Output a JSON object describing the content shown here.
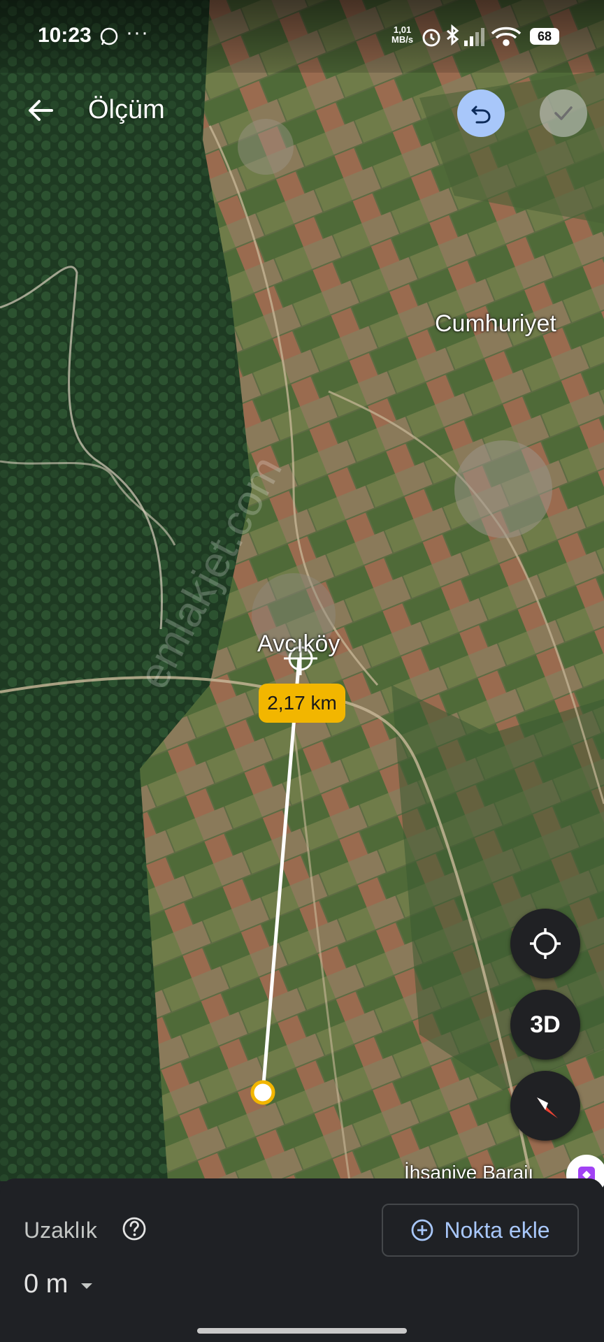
{
  "status_bar": {
    "time": "10:23",
    "dots": "···",
    "speed_value": "1,01",
    "speed_unit": "MB/s",
    "battery": "68"
  },
  "header": {
    "title": "Ölçüm",
    "back_icon": "arrow-left-icon",
    "undo_icon": "undo-icon",
    "done_icon": "check-icon"
  },
  "map": {
    "labels": {
      "village_1": "Cumhuriyet",
      "village_2": "Avcıköy",
      "village_3": "İhsaniye Barajı"
    },
    "distance_label": "2,17 km",
    "watermark": "emlakjet.com"
  },
  "controls": {
    "locate_icon": "my-location-icon",
    "view_3d_label": "3D",
    "compass_icon": "compass-icon"
  },
  "bottom_sheet": {
    "distance_title": "Uzaklık",
    "distance_value": "0 m",
    "add_point_label": "Nokta ekle",
    "help_icon": "help-icon"
  },
  "colors": {
    "accent": "#a8c7fa",
    "distance_pill": "#f2b600",
    "sheet_bg": "#1f2125"
  }
}
